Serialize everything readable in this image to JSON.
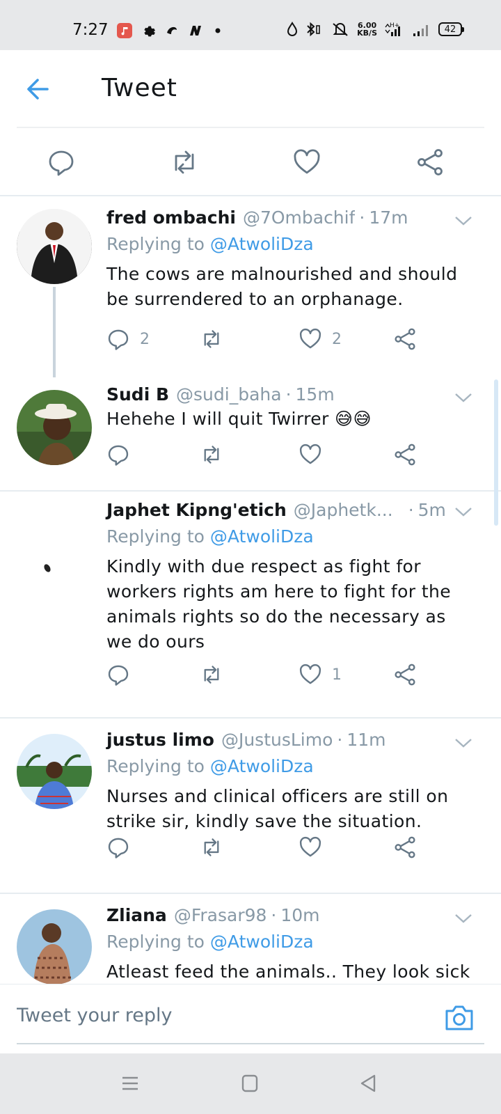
{
  "status_bar": {
    "time": "7:27",
    "net_speed_value": "6.00",
    "net_speed_unit": "KB/S",
    "battery": "42"
  },
  "header": {
    "title": "Tweet"
  },
  "replies": [
    {
      "name": "fred ombachi",
      "handle": "@7Ombachif",
      "time": "17m",
      "replying_prefix": "Replying to",
      "replying_to": "@AtwoliDza",
      "text": "The cows are malnourished and should be surrendered to an orphanage.",
      "reply_count": "2",
      "retweet_count": "",
      "like_count": "2"
    },
    {
      "name": "Sudi B",
      "handle": "@sudi_baha",
      "time": "15m",
      "text": "Hehehe I will quit Twirrer 😅😅",
      "reply_count": "",
      "retweet_count": "",
      "like_count": ""
    },
    {
      "name": "Japhet Kipng'etich",
      "handle": "@Japhetk...",
      "time": "5m",
      "replying_prefix": "Replying to",
      "replying_to": "@AtwoliDza",
      "text": "Kindly with due respect as fight for workers rights am here to fight for the animals rights so do the necessary as we do ours",
      "reply_count": "",
      "retweet_count": "",
      "like_count": "1"
    },
    {
      "name": "justus limo",
      "handle": "@JustusLimo",
      "time": "11m",
      "replying_prefix": "Replying to",
      "replying_to": "@AtwoliDza",
      "text": "Nurses and clinical officers are still on strike sir, kindly save the situation.",
      "reply_count": "",
      "retweet_count": "",
      "like_count": ""
    },
    {
      "name": "Zliana",
      "handle": "@Frasar98",
      "time": "10m",
      "replying_prefix": "Replying to",
      "replying_to": "@AtwoliDza",
      "text": "Atleast feed the animals.. They look sick"
    }
  ],
  "reply_box": {
    "placeholder": "Tweet your reply"
  },
  "colors": {
    "accent": "#3f9be6",
    "muted": "#8899a6",
    "text": "#14171a",
    "divider": "#e6ecf0",
    "system_bar": "#e7e8ea"
  }
}
